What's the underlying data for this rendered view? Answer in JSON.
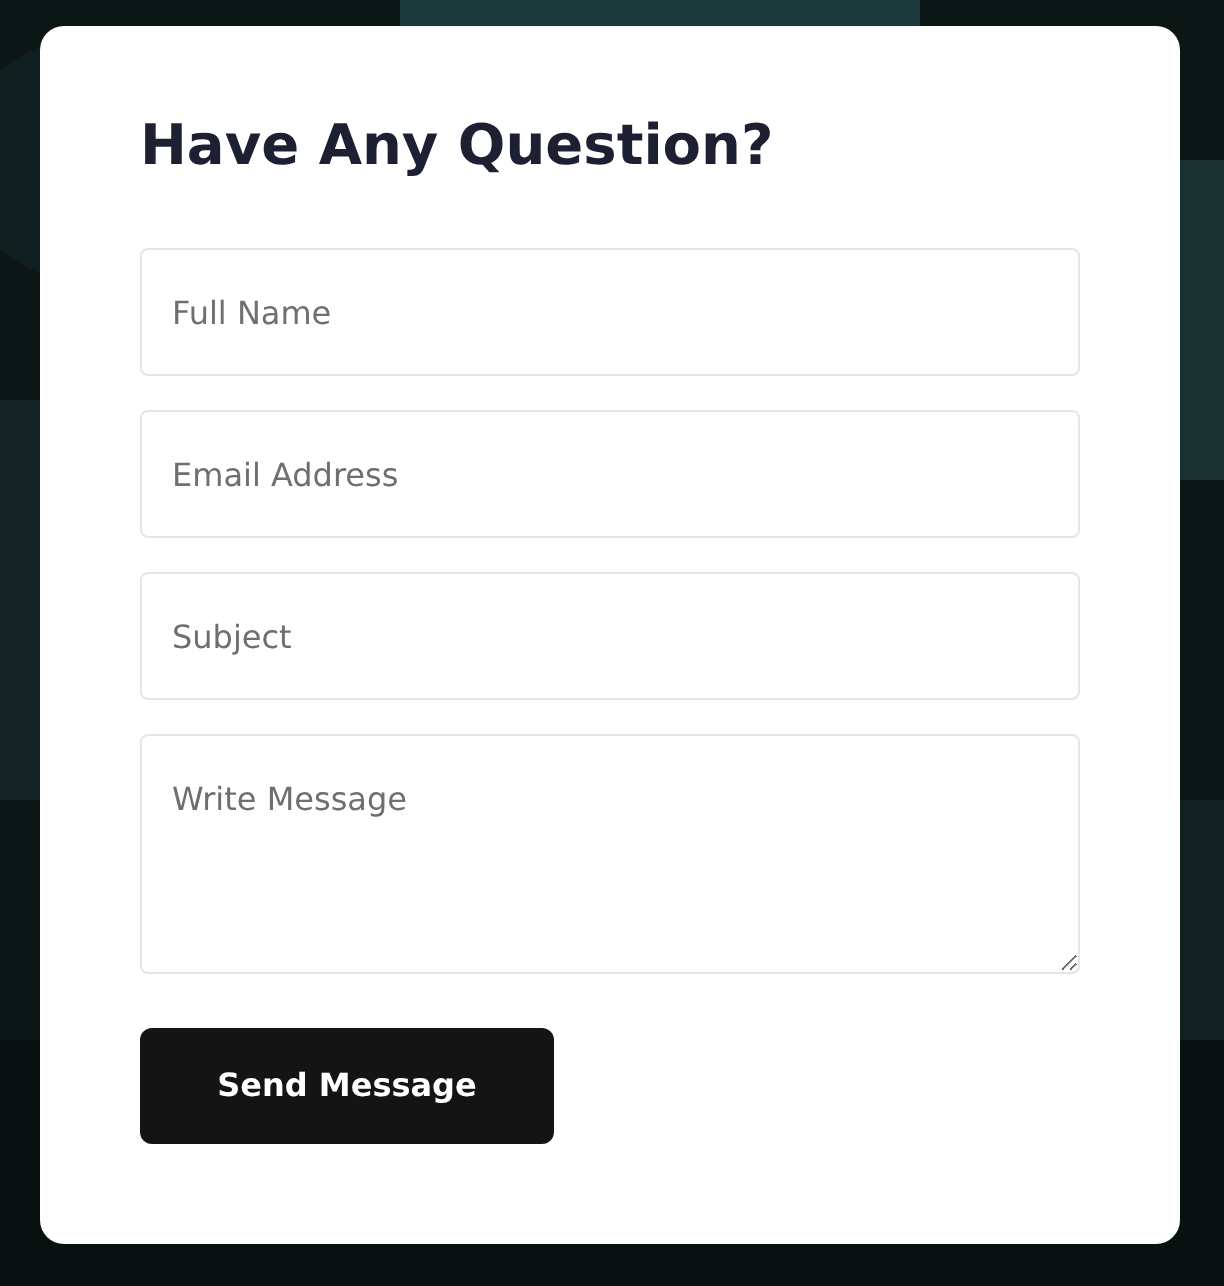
{
  "form": {
    "title": "Have Any Question?",
    "fields": [
      {
        "kind": "input",
        "placeholder": "Full Name"
      },
      {
        "kind": "input",
        "placeholder": "Email Address"
      },
      {
        "kind": "input",
        "placeholder": "Subject"
      },
      {
        "kind": "textarea",
        "placeholder": "Write Message"
      }
    ],
    "submit": {
      "label": "Send Message"
    }
  }
}
